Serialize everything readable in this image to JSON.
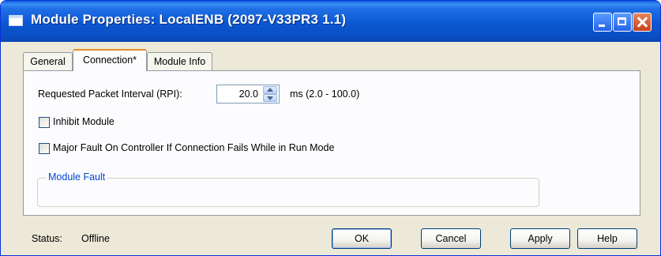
{
  "window": {
    "title": "Module Properties: LocalENB (2097-V33PR3 1.1)"
  },
  "tabs": [
    {
      "label": "General"
    },
    {
      "label": "Connection*"
    },
    {
      "label": "Module Info"
    }
  ],
  "connection": {
    "rpi_label": "Requested Packet Interval (RPI):",
    "rpi_value": "20.0",
    "rpi_range": "ms (2.0 - 100.0)",
    "inhibit_label": "Inhibit Module",
    "major_fault_label": "Major Fault On Controller If Connection Fails While in Run Mode",
    "module_fault_label": "Module Fault"
  },
  "status": {
    "label": "Status:",
    "value": "Offline"
  },
  "buttons": {
    "ok": "OK",
    "cancel": "Cancel",
    "apply": "Apply",
    "help": "Help"
  },
  "colors": {
    "titlebar": "#0b57d0",
    "dialog_bg": "#ece9d8",
    "active_tab_accent": "#e68b2c",
    "group_label": "#0046d5"
  }
}
